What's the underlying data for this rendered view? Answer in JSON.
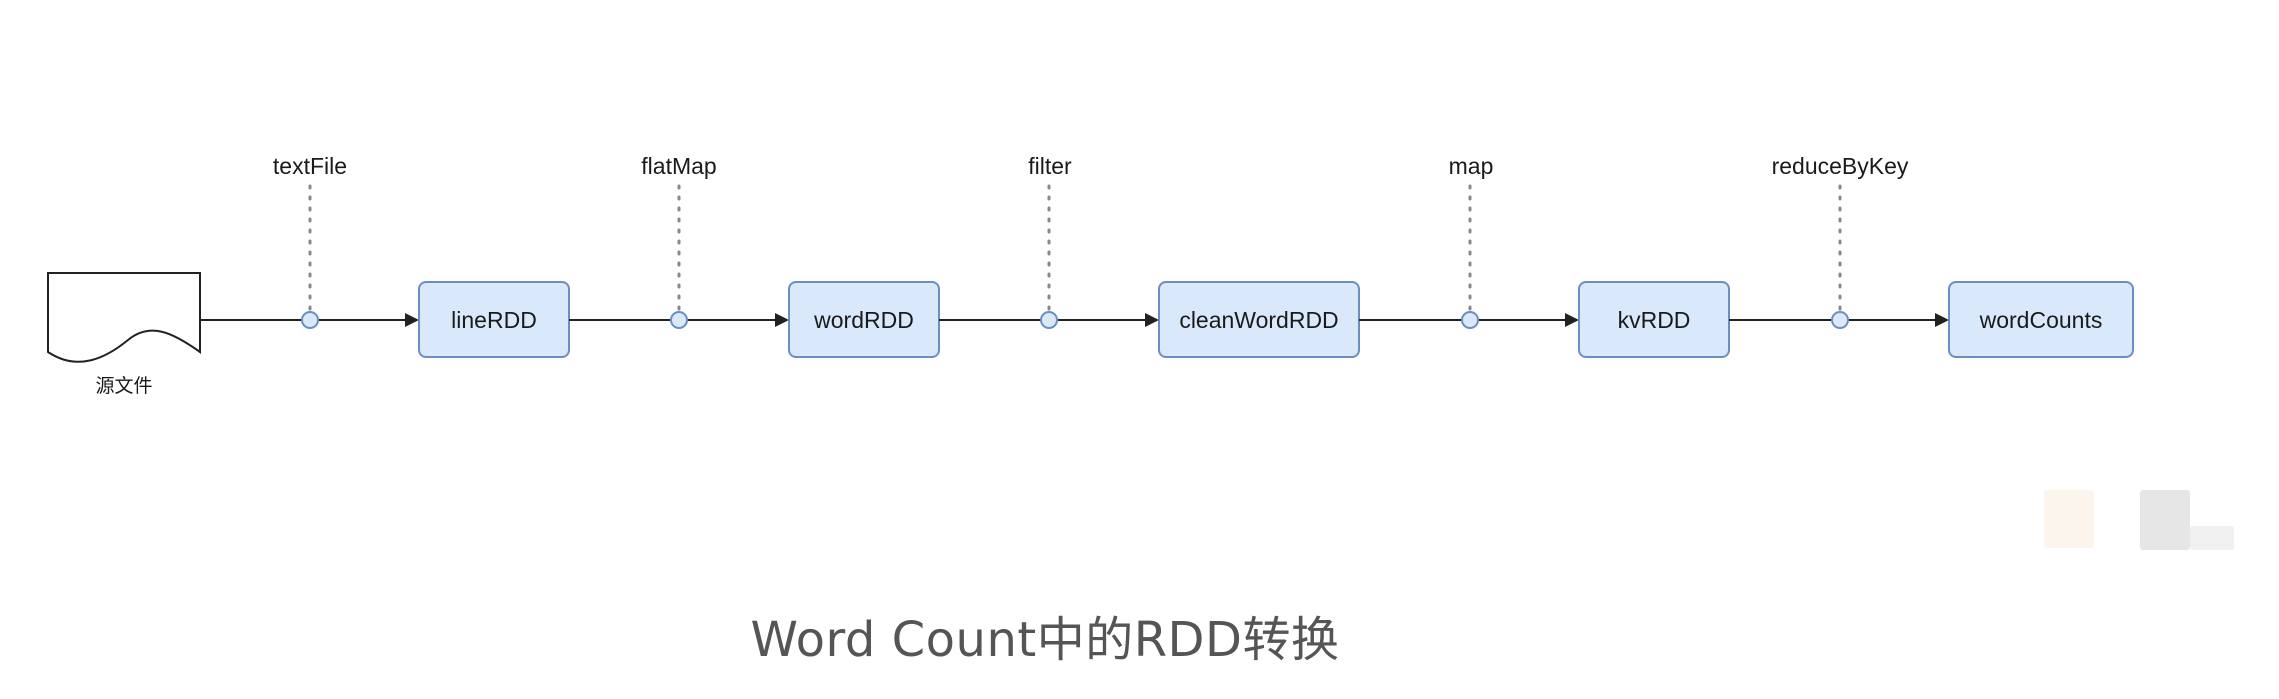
{
  "source": {
    "label": "源文件"
  },
  "nodes": [
    {
      "id": "line",
      "label": "lineRDD"
    },
    {
      "id": "word",
      "label": "wordRDD"
    },
    {
      "id": "clean",
      "label": "cleanWordRDD"
    },
    {
      "id": "kv",
      "label": "kvRDD"
    },
    {
      "id": "counts",
      "label": "wordCounts"
    }
  ],
  "operations": [
    {
      "id": "textfile",
      "label": "textFile"
    },
    {
      "id": "flatmap",
      "label": "flatMap"
    },
    {
      "id": "filter",
      "label": "filter"
    },
    {
      "id": "map",
      "label": "map"
    },
    {
      "id": "reducebykey",
      "label": "reduceByKey"
    }
  ],
  "caption": "Word Count中的RDD转换",
  "colors": {
    "node_fill": "#dae8fc",
    "node_stroke": "#6c8ebf",
    "edge": "#222222",
    "caption": "#555555"
  }
}
